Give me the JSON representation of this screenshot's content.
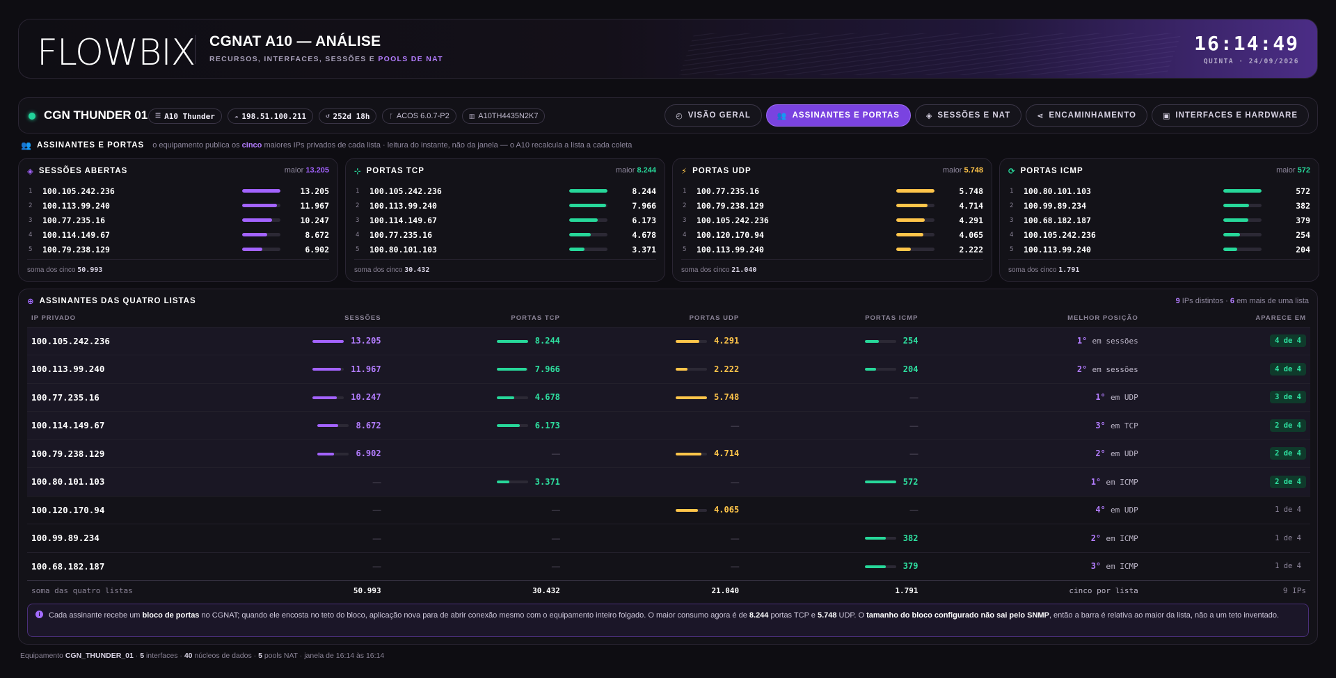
{
  "header": {
    "logo": "FLOWBIX",
    "title": "CGNAT A10 — ANÁLISE",
    "subtitle": "RECURSOS, INTERFACES, SESSÕES E",
    "subtitle_hl": "POOLS DE NAT",
    "clock": "16:14:49",
    "date": "QUINTA · 24/09/2026"
  },
  "device": {
    "name": "CGN THUNDER 01",
    "chips": [
      "A10 Thunder",
      "198.51.100.211",
      "252d 18h",
      "ACOS 6.0.7-P2",
      "A10TH4435N2K7"
    ],
    "tabs": [
      "VISÃO GERAL",
      "ASSINANTES E PORTAS",
      "SESSÕES E NAT",
      "ENCAMINHAMENTO",
      "INTERFACES E HARDWARE"
    ]
  },
  "section": {
    "title": "ASSINANTES E PORTAS",
    "desc_a": "o equipamento publica os",
    "desc_b": "cinco",
    "desc_c": "maiores IPs privados de cada lista · leitura do instante, não da janela — o A10 recalcula a lista a cada coleta"
  },
  "cards": [
    {
      "title": "SESSÕES ABERTAS",
      "max_label": "maior",
      "max": "13.205",
      "color": "#a363ff",
      "rows": [
        {
          "rank": "1",
          "ip": "100.105.242.236",
          "value": "13.205",
          "frac": 1.0
        },
        {
          "rank": "2",
          "ip": "100.113.99.240",
          "value": "11.967",
          "frac": 0.906
        },
        {
          "rank": "3",
          "ip": "100.77.235.16",
          "value": "10.247",
          "frac": 0.776
        },
        {
          "rank": "4",
          "ip": "100.114.149.67",
          "value": "8.672",
          "frac": 0.657
        },
        {
          "rank": "5",
          "ip": "100.79.238.129",
          "value": "6.902",
          "frac": 0.523
        }
      ],
      "sum_label": "soma dos cinco",
      "sum": "50.993"
    },
    {
      "title": "PORTAS TCP",
      "max_label": "maior",
      "max": "8.244",
      "color": "#27d89a",
      "rows": [
        {
          "rank": "1",
          "ip": "100.105.242.236",
          "value": "8.244",
          "frac": 1.0
        },
        {
          "rank": "2",
          "ip": "100.113.99.240",
          "value": "7.966",
          "frac": 0.966
        },
        {
          "rank": "3",
          "ip": "100.114.149.67",
          "value": "6.173",
          "frac": 0.749
        },
        {
          "rank": "4",
          "ip": "100.77.235.16",
          "value": "4.678",
          "frac": 0.567
        },
        {
          "rank": "5",
          "ip": "100.80.101.103",
          "value": "3.371",
          "frac": 0.409
        }
      ],
      "sum_label": "soma dos cinco",
      "sum": "30.432"
    },
    {
      "title": "PORTAS UDP",
      "max_label": "maior",
      "max": "5.748",
      "color": "#ffc54a",
      "rows": [
        {
          "rank": "1",
          "ip": "100.77.235.16",
          "value": "5.748",
          "frac": 1.0
        },
        {
          "rank": "2",
          "ip": "100.79.238.129",
          "value": "4.714",
          "frac": 0.82
        },
        {
          "rank": "3",
          "ip": "100.105.242.236",
          "value": "4.291",
          "frac": 0.746
        },
        {
          "rank": "4",
          "ip": "100.120.170.94",
          "value": "4.065",
          "frac": 0.707
        },
        {
          "rank": "5",
          "ip": "100.113.99.240",
          "value": "2.222",
          "frac": 0.387
        }
      ],
      "sum_label": "soma dos cinco",
      "sum": "21.040"
    },
    {
      "title": "PORTAS ICMP",
      "max_label": "maior",
      "max": "572",
      "color": "#27d89a",
      "rows": [
        {
          "rank": "1",
          "ip": "100.80.101.103",
          "value": "572",
          "frac": 1.0
        },
        {
          "rank": "2",
          "ip": "100.99.89.234",
          "value": "382",
          "frac": 0.668
        },
        {
          "rank": "3",
          "ip": "100.68.182.187",
          "value": "379",
          "frac": 0.663
        },
        {
          "rank": "4",
          "ip": "100.105.242.236",
          "value": "254",
          "frac": 0.444
        },
        {
          "rank": "5",
          "ip": "100.113.99.240",
          "value": "204",
          "frac": 0.357
        }
      ],
      "sum_label": "soma dos cinco",
      "sum": "1.791"
    }
  ],
  "table": {
    "title": "ASSINANTES DAS QUATRO LISTAS",
    "summary_a": "9",
    "summary_b": "IPs distintos ·",
    "summary_c": "6",
    "summary_d": "em mais de uma lista",
    "headers": [
      "IP PRIVADO",
      "SESSÕES",
      "PORTAS TCP",
      "PORTAS UDP",
      "PORTAS ICMP",
      "MELHOR POSIÇÃO",
      "APARECE EM"
    ],
    "dash": "—",
    "rows": [
      {
        "ip": "100.105.242.236",
        "sess": "13.205",
        "sess_f": 1.0,
        "tcp": "8.244",
        "tcp_f": 1.0,
        "udp": "4.291",
        "udp_f": 0.746,
        "icmp": "254",
        "icmp_f": 0.444,
        "pos": "1°",
        "pos_in": "em sessões",
        "appear": "4 de 4",
        "multi": true
      },
      {
        "ip": "100.113.99.240",
        "sess": "11.967",
        "sess_f": 0.906,
        "tcp": "7.966",
        "tcp_f": 0.966,
        "udp": "2.222",
        "udp_f": 0.387,
        "icmp": "204",
        "icmp_f": 0.357,
        "pos": "2°",
        "pos_in": "em sessões",
        "appear": "4 de 4",
        "multi": true
      },
      {
        "ip": "100.77.235.16",
        "sess": "10.247",
        "sess_f": 0.776,
        "tcp": "4.678",
        "tcp_f": 0.567,
        "udp": "5.748",
        "udp_f": 1.0,
        "icmp": "",
        "icmp_f": 0,
        "pos": "1°",
        "pos_in": "em UDP",
        "appear": "3 de 4",
        "multi": true
      },
      {
        "ip": "100.114.149.67",
        "sess": "8.672",
        "sess_f": 0.657,
        "tcp": "6.173",
        "tcp_f": 0.749,
        "udp": "",
        "udp_f": 0,
        "icmp": "",
        "icmp_f": 0,
        "pos": "3°",
        "pos_in": "em TCP",
        "appear": "2 de 4",
        "multi": true
      },
      {
        "ip": "100.79.238.129",
        "sess": "6.902",
        "sess_f": 0.523,
        "tcp": "",
        "tcp_f": 0,
        "udp": "4.714",
        "udp_f": 0.82,
        "icmp": "",
        "icmp_f": 0,
        "pos": "2°",
        "pos_in": "em UDP",
        "appear": "2 de 4",
        "multi": true
      },
      {
        "ip": "100.80.101.103",
        "sess": "",
        "sess_f": 0,
        "tcp": "3.371",
        "tcp_f": 0.409,
        "udp": "",
        "udp_f": 0,
        "icmp": "572",
        "icmp_f": 1.0,
        "pos": "1°",
        "pos_in": "em ICMP",
        "appear": "2 de 4",
        "multi": true
      },
      {
        "ip": "100.120.170.94",
        "sess": "",
        "sess_f": 0,
        "tcp": "",
        "tcp_f": 0,
        "udp": "4.065",
        "udp_f": 0.707,
        "icmp": "",
        "icmp_f": 0,
        "pos": "4°",
        "pos_in": "em UDP",
        "appear": "1 de 4",
        "multi": false
      },
      {
        "ip": "100.99.89.234",
        "sess": "",
        "sess_f": 0,
        "tcp": "",
        "tcp_f": 0,
        "udp": "",
        "udp_f": 0,
        "icmp": "382",
        "icmp_f": 0.668,
        "pos": "2°",
        "pos_in": "em ICMP",
        "appear": "1 de 4",
        "multi": false
      },
      {
        "ip": "100.68.182.187",
        "sess": "",
        "sess_f": 0,
        "tcp": "",
        "tcp_f": 0,
        "udp": "",
        "udp_f": 0,
        "icmp": "379",
        "icmp_f": 0.663,
        "pos": "3°",
        "pos_in": "em ICMP",
        "appear": "1 de 4",
        "multi": false
      }
    ],
    "footer": [
      "soma das quatro listas",
      "50.993",
      "30.432",
      "21.040",
      "1.791",
      "cinco por lista",
      "9 IPs"
    ]
  },
  "info": {
    "t1": "Cada assinante recebe um",
    "b1": "bloco de portas",
    "t2": "no CGNAT; quando ele encosta no teto do bloco, aplicação nova para de abrir conexão mesmo com o equipamento inteiro folgado. O maior consumo agora é de",
    "b2": "8.244",
    "t3": "portas TCP e",
    "b3": "5.748",
    "t4": "UDP. O",
    "b4": "tamanho do bloco configurado não sai pelo SNMP",
    "t5": ", então a barra é relativa ao maior da lista, não a um teto inventado."
  },
  "footer": {
    "a": "Equipamento",
    "b": "CGN_THUNDER_01",
    "c": "·",
    "d": "5",
    "e": "interfaces ·",
    "f": "40",
    "g": "núcleos de dados ·",
    "h": "5",
    "i": "pools NAT · janela de 16:14 às 16:14"
  },
  "colors": {
    "sessions": "#a363ff",
    "tcp": "#27d89a",
    "udp": "#ffc54a",
    "icmp": "#27d89a",
    "accent": "#7a43e0"
  }
}
